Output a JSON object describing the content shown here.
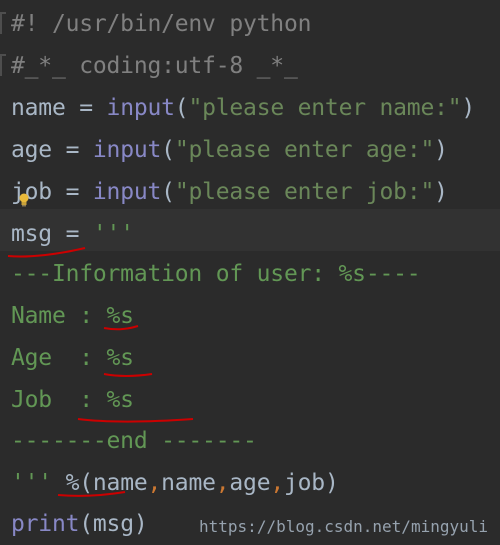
{
  "editor": {
    "lines": {
      "l1": "#! /usr/bin/env python",
      "l2": "#_*_ coding:utf-8 _*_",
      "l3_var": "name",
      "l3_eq": " = ",
      "l3_fn": "input",
      "l3_open": "(",
      "l3_str": "\"please enter name:\"",
      "l3_close": ")",
      "l4_var": "age",
      "l4_eq": " = ",
      "l4_fn": "input",
      "l4_open": "(",
      "l4_str": "\"please enter age:\"",
      "l4_close": ")",
      "l5_var": "job",
      "l5_eq": " = ",
      "l5_fn": "input",
      "l5_open": "(",
      "l5_str": "\"please enter job:\"",
      "l5_close": ")",
      "l6_var": "msg",
      "l6_eq": " = ",
      "l6_str": "'''",
      "l7": "---Information of user: %s----",
      "l8": "Name : %s",
      "l9": "Age  : %s",
      "l10": "Job  : %s",
      "l11": "-------end -------",
      "l12_str": "'''",
      "l12_pct": " %(",
      "l12_a": "name",
      "l12_c1": ",",
      "l12_b": "name",
      "l12_c2": ",",
      "l12_c": "age",
      "l12_c3": ",",
      "l12_d": "job",
      "l12_close": ")",
      "l13_fn": "print",
      "l13_args": "(msg)"
    },
    "watermark": "https://blog.csdn.net/mingyuli"
  },
  "colors": {
    "background": "#2b2b2b",
    "comment": "#808080",
    "builtin": "#8888c6",
    "string": "#6a8759",
    "identifier": "#a9b7c6",
    "comma": "#cc7832",
    "annotation": "#cc0000"
  }
}
